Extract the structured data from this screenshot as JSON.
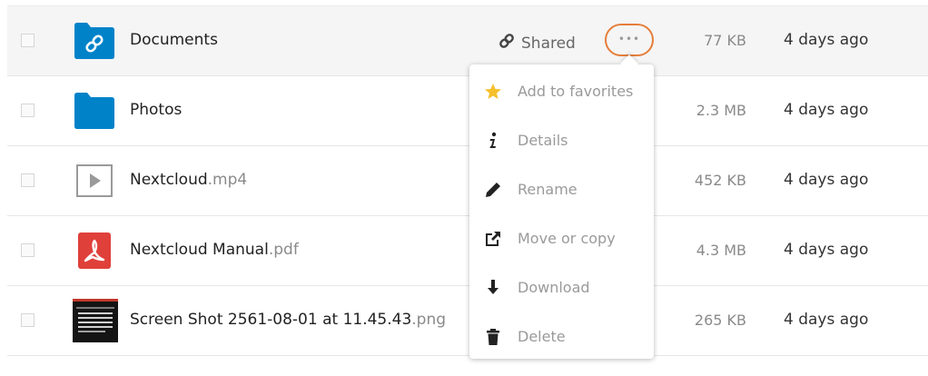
{
  "files": [
    {
      "name": "Documents",
      "ext": "",
      "size": "77 KB",
      "modified": "4 days ago",
      "icon": "shared-folder-icon"
    },
    {
      "name": "Photos",
      "ext": "",
      "size": "2.3 MB",
      "modified": "4 days ago",
      "icon": "folder-icon"
    },
    {
      "name": "Nextcloud",
      "ext": ".mp4",
      "size": "452 KB",
      "modified": "4 days ago",
      "icon": "video-file-icon"
    },
    {
      "name": "Nextcloud Manual",
      "ext": ".pdf",
      "size": "4.3 MB",
      "modified": "4 days ago",
      "icon": "pdf-file-icon"
    },
    {
      "name": "Screen Shot 2561-08-01 at 11.45.43",
      "ext": ".png",
      "size": "265 KB",
      "modified": "4 days ago",
      "icon": "image-thumbnail"
    }
  ],
  "shared_label": "Shared",
  "more_label": "•••",
  "menu": {
    "items": [
      {
        "label": "Add to favorites",
        "icon": "star-icon"
      },
      {
        "label": "Details",
        "icon": "info-icon"
      },
      {
        "label": "Rename",
        "icon": "pencil-icon"
      },
      {
        "label": "Move or copy",
        "icon": "external-link-icon"
      },
      {
        "label": "Download",
        "icon": "download-icon"
      },
      {
        "label": "Delete",
        "icon": "trash-icon"
      }
    ]
  },
  "colors": {
    "folder": "#0082c9",
    "pdf": "#e0403a",
    "star": "#f5c02b",
    "highlight_ring": "#e67e3a"
  }
}
